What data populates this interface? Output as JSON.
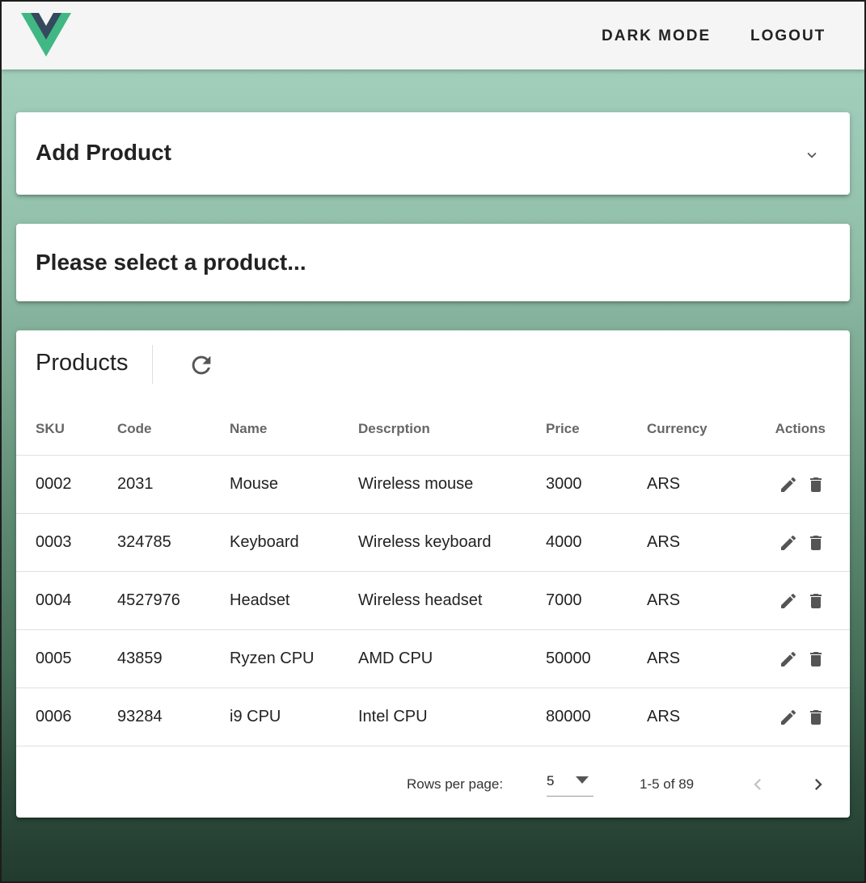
{
  "header": {
    "dark_mode_label": "DARK MODE",
    "logout_label": "LOGOUT"
  },
  "add_product": {
    "title": "Add Product"
  },
  "selection": {
    "title": "Please select a product..."
  },
  "products": {
    "title": "Products",
    "columns": [
      "SKU",
      "Code",
      "Name",
      "Descrption",
      "Price",
      "Currency",
      "Actions"
    ],
    "rows": [
      [
        "0002",
        "2031",
        "Mouse",
        "Wireless mouse",
        "3000",
        "ARS"
      ],
      [
        "0003",
        "324785",
        "Keyboard",
        "Wireless keyboard",
        "4000",
        "ARS"
      ],
      [
        "0004",
        "4527976",
        "Headset",
        "Wireless headset",
        "7000",
        "ARS"
      ],
      [
        "0005",
        "43859",
        "Ryzen CPU",
        "AMD CPU",
        "50000",
        "ARS"
      ],
      [
        "0006",
        "93284",
        "i9 CPU",
        "Intel CPU",
        "80000",
        "ARS"
      ]
    ],
    "footer": {
      "rows_per_page_label": "Rows per page:",
      "rows_per_page_value": "5",
      "range": "1-5 of 89"
    }
  },
  "icons": {
    "logo": "vue-logo",
    "expand": "chevron-down-icon",
    "refresh": "refresh-icon",
    "edit": "pencil-icon",
    "delete": "trash-icon",
    "prev": "chevron-left-icon",
    "next": "chevron-right-icon",
    "dropdown": "caret-down-icon"
  },
  "colors": {
    "logo_green": "#41b883",
    "logo_dark": "#35495e",
    "accent_bg": "#a6d4c0"
  }
}
